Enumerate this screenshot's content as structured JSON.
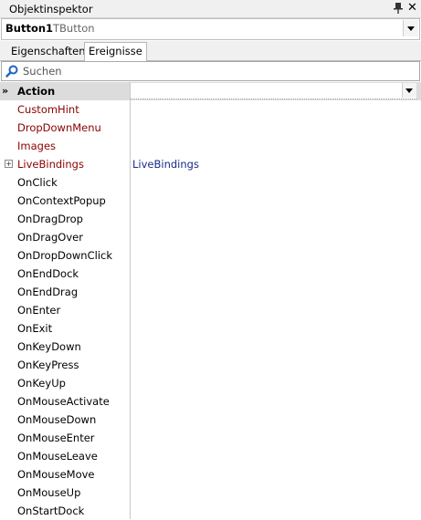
{
  "window": {
    "title": "Objektinspektor"
  },
  "component": {
    "name": "Button1",
    "type": "TButton"
  },
  "tabs": [
    {
      "label": "Eigenschaften",
      "active": false
    },
    {
      "label": "Ereignisse",
      "active": true
    }
  ],
  "search": {
    "placeholder": "Suchen"
  },
  "events": [
    {
      "name": "Action",
      "value": "",
      "selected": true,
      "color": "default"
    },
    {
      "name": "CustomHint",
      "value": "",
      "color": "red"
    },
    {
      "name": "DropDownMenu",
      "value": "",
      "color": "red"
    },
    {
      "name": "Images",
      "value": "",
      "color": "red"
    },
    {
      "name": "LiveBindings",
      "value": "LiveBindings",
      "color": "red",
      "expandable": true
    },
    {
      "name": "OnClick",
      "value": ""
    },
    {
      "name": "OnContextPopup",
      "value": ""
    },
    {
      "name": "OnDragDrop",
      "value": ""
    },
    {
      "name": "OnDragOver",
      "value": ""
    },
    {
      "name": "OnDropDownClick",
      "value": ""
    },
    {
      "name": "OnEndDock",
      "value": ""
    },
    {
      "name": "OnEndDrag",
      "value": ""
    },
    {
      "name": "OnEnter",
      "value": ""
    },
    {
      "name": "OnExit",
      "value": ""
    },
    {
      "name": "OnKeyDown",
      "value": ""
    },
    {
      "name": "OnKeyPress",
      "value": ""
    },
    {
      "name": "OnKeyUp",
      "value": ""
    },
    {
      "name": "OnMouseActivate",
      "value": ""
    },
    {
      "name": "OnMouseDown",
      "value": ""
    },
    {
      "name": "OnMouseEnter",
      "value": ""
    },
    {
      "name": "OnMouseLeave",
      "value": ""
    },
    {
      "name": "OnMouseMove",
      "value": ""
    },
    {
      "name": "OnMouseUp",
      "value": ""
    },
    {
      "name": "OnStartDock",
      "value": ""
    }
  ],
  "colors": {
    "reference": "#8b0000",
    "value_link": "#1a2a8c",
    "selected_row": "#dcdcdc"
  },
  "icons": {
    "pin": "pin-icon",
    "close": "close-icon",
    "search": "magnifier-icon",
    "expand": "plus-box-icon",
    "selection": "double-chevron-right-icon"
  }
}
